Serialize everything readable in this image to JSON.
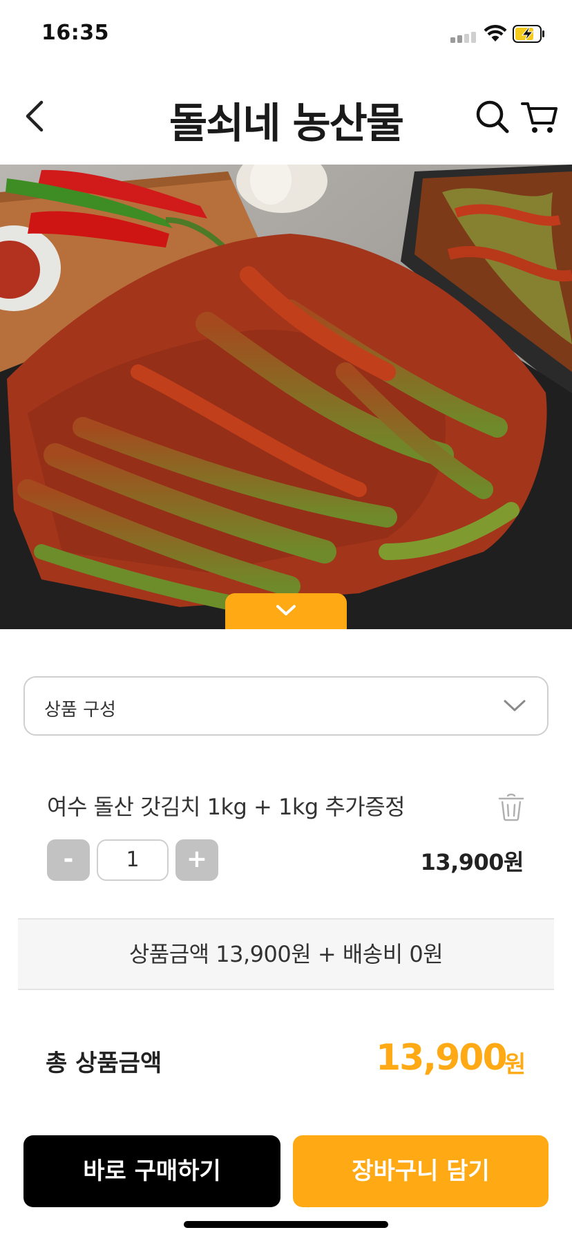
{
  "status_bar": {
    "time": "16:35"
  },
  "header": {
    "title": "돌쇠네 농산물"
  },
  "hero": {
    "expand_icon": "chevron-down-icon"
  },
  "option_select": {
    "label": "상품 구성"
  },
  "selected_item": {
    "name": "여수 돌산 갓김치 1kg + 1kg 추가증정",
    "minus_label": "-",
    "quantity": "1",
    "plus_label": "+",
    "price": "13,900원"
  },
  "summary": {
    "text": "상품금액 13,900원 + 배송비 0원"
  },
  "total": {
    "label": "총 상품금액",
    "value": "13,900",
    "unit": "원"
  },
  "buttons": {
    "buy_now": "바로 구매하기",
    "add_to_cart": "장바구니 담기"
  },
  "colors": {
    "accent": "#FFAA14",
    "primary_button": "#000000"
  }
}
